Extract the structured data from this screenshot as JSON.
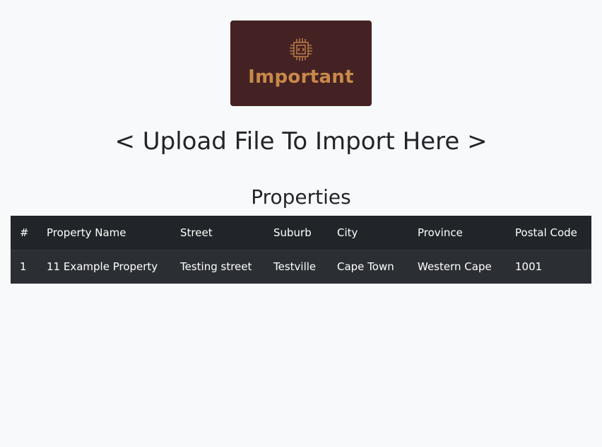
{
  "logo": {
    "icon": "chip-icon",
    "text": "Important",
    "bg_color": "#442224",
    "accent_color": "#c8894a"
  },
  "upload_heading": "< Upload File To Import Here >",
  "section_title": "Properties",
  "table": {
    "headers": [
      "#",
      "Property Name",
      "Street",
      "Suburb",
      "City",
      "Province",
      "Postal Code"
    ],
    "rows": [
      [
        "1",
        "11 Example Property",
        "Testing street",
        "Testville",
        "Cape Town",
        "Western Cape",
        "1001"
      ]
    ]
  }
}
